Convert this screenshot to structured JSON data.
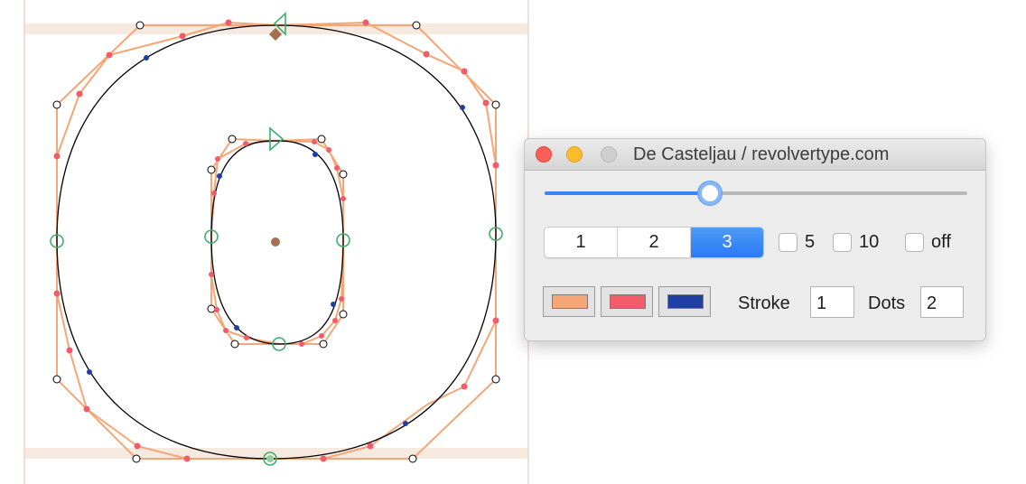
{
  "window": {
    "title": "De Casteljau / revolvertype.com"
  },
  "slider": {
    "value": 0.39
  },
  "segmented": {
    "options": [
      "1",
      "2",
      "3"
    ],
    "selected_index": 2
  },
  "checkboxes": [
    {
      "label": "5",
      "checked": false
    },
    {
      "label": "10",
      "checked": false
    },
    {
      "label": "off",
      "checked": false
    }
  ],
  "swatches": [
    {
      "name": "stroke-color",
      "color": "#f5a676"
    },
    {
      "name": "dot-color",
      "color": "#f25c6a"
    },
    {
      "name": "point-color",
      "color": "#1f3fa3"
    }
  ],
  "fields": {
    "stroke_label": "Stroke",
    "stroke_value": "1",
    "dots_label": "Dots",
    "dots_value": "2"
  },
  "colors": {
    "outline": "#000000",
    "construction": "#f5a676",
    "dots": "#f25c6a",
    "point": "#1f3fa3",
    "oncurve": "#3fae6d",
    "anchor": "#a36f4d",
    "guides": "#f4e6dc"
  }
}
